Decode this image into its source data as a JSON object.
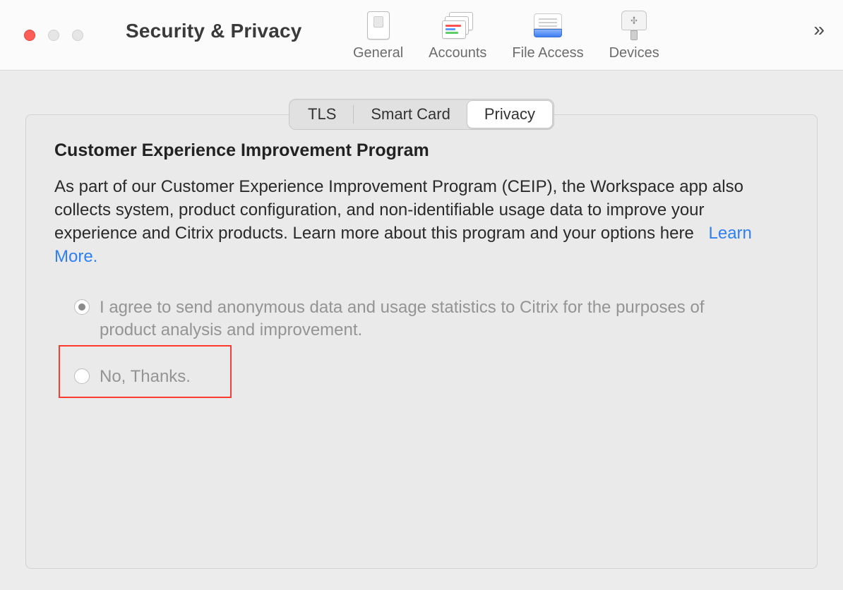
{
  "window": {
    "title": "Security & Privacy"
  },
  "toolbar": {
    "items": [
      {
        "label": "General"
      },
      {
        "label": "Accounts"
      },
      {
        "label": "File Access"
      },
      {
        "label": "Devices"
      }
    ],
    "more": "»"
  },
  "segments": {
    "tls": "TLS",
    "smartcard": "Smart Card",
    "privacy": "Privacy"
  },
  "panel": {
    "heading": "Customer Experience Improvement Program",
    "description": "As part of our Customer Experience Improvement Program (CEIP), the Workspace app also collects system, product configuration, and non-identifiable usage data to improve your experience and Citrix products. Learn more about this program and your options here",
    "learn_more": "Learn More."
  },
  "radios": {
    "agree": "I agree to send anonymous data and usage statistics to Citrix for the purposes of product analysis and improvement.",
    "decline": "No, Thanks."
  }
}
